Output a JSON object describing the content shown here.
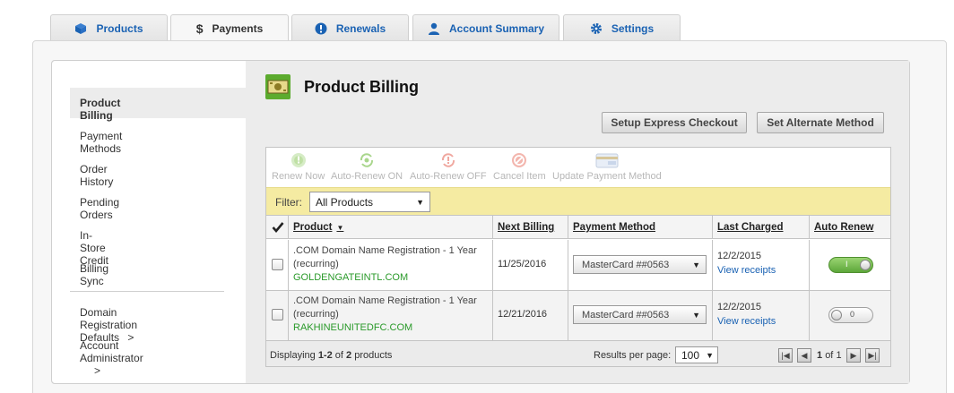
{
  "tabs": [
    {
      "label": "Products",
      "icon": "cube-icon"
    },
    {
      "label": "Payments",
      "icon": "dollar-icon"
    },
    {
      "label": "Renewals",
      "icon": "exclamation-icon"
    },
    {
      "label": "Account Summary",
      "icon": "user-icon"
    },
    {
      "label": "Settings",
      "icon": "gear-icon"
    }
  ],
  "sidebar": {
    "items": [
      {
        "label": "Product Billing"
      },
      {
        "label": "Payment Methods"
      },
      {
        "label": "Order History"
      },
      {
        "label": "Pending Orders"
      },
      {
        "label": "In-Store Credit"
      },
      {
        "label": "Billing Sync"
      },
      {
        "label": "Domain Registration Defaults"
      },
      {
        "label": "Account Administrator"
      }
    ],
    "chevron": ">"
  },
  "page": {
    "title": "Product Billing"
  },
  "buttons": {
    "express": "Setup Express Checkout",
    "alternate": "Set Alternate Method"
  },
  "toolbar": [
    {
      "label": "Renew Now",
      "icon": "renew-icon"
    },
    {
      "label": "Auto-Renew ON",
      "icon": "auto-renew-on-icon"
    },
    {
      "label": "Auto-Renew OFF",
      "icon": "auto-renew-off-icon"
    },
    {
      "label": "Cancel Item",
      "icon": "cancel-icon"
    },
    {
      "label": "Update Payment Method",
      "icon": "payment-card-icon"
    }
  ],
  "filter": {
    "label": "Filter:",
    "value": "All Products"
  },
  "table": {
    "columns": {
      "product": "Product",
      "next_billing": "Next Billing",
      "payment_method": "Payment Method",
      "last_charged": "Last Charged",
      "auto_renew": "Auto Renew"
    },
    "rows": [
      {
        "product_line1": ".COM Domain Name Registration - 1 Year",
        "product_line2": "(recurring)",
        "domain": "GOLDENGATEINTL.COM",
        "next_billing": "11/25/2016",
        "payment_method": "MasterCard ##0563",
        "last_charged": "12/2/2015",
        "receipts": "View receipts",
        "auto_renew": "I",
        "auto_renew_on": true
      },
      {
        "product_line1": ".COM Domain Name Registration - 1 Year",
        "product_line2": "(recurring)",
        "domain": "RAKHINEUNITEDFC.COM",
        "next_billing": "12/21/2016",
        "payment_method": "MasterCard ##0563",
        "last_charged": "12/2/2015",
        "receipts": "View receipts",
        "auto_renew": "0",
        "auto_renew_on": false
      }
    ]
  },
  "footer": {
    "prefix": "Displaying",
    "range": "1-2",
    "of": "of",
    "total": "2",
    "suffix": "products",
    "per_page_label": "Results per page:",
    "per_page_value": "100",
    "page": "1",
    "page_of": "of",
    "pages": "1"
  },
  "colors": {
    "accent": "#1a62b3",
    "domain": "#2a9a2a",
    "filterbar": "#f5eba2",
    "toggle_on": "#5da73a"
  }
}
